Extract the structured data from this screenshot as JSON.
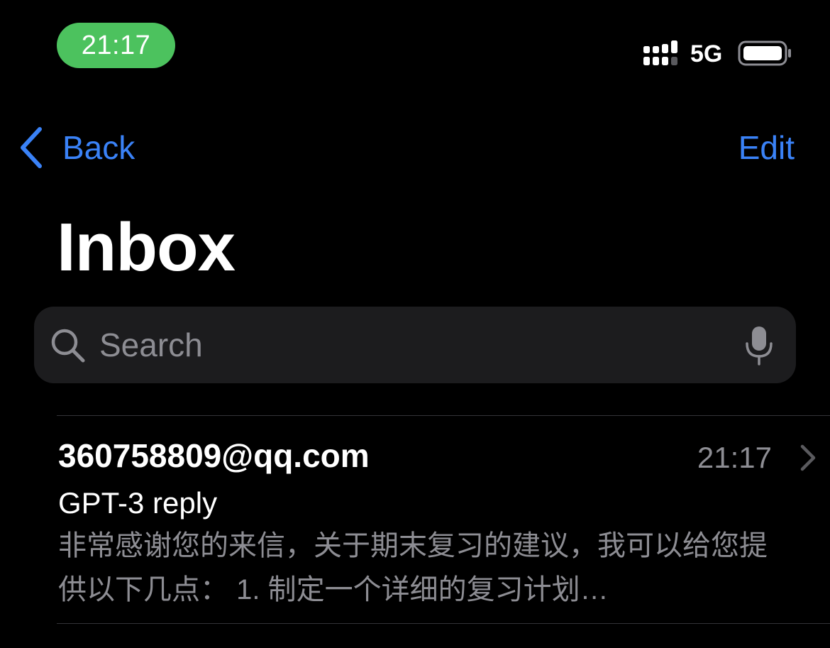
{
  "status_bar": {
    "time": "21:17",
    "network": "5G",
    "icons": [
      "signal-icon",
      "battery-icon"
    ],
    "time_pill_color": "#4cc25e"
  },
  "nav": {
    "back_label": "Back",
    "edit_label": "Edit",
    "accent_color": "#3a82f7"
  },
  "page": {
    "title": "Inbox"
  },
  "search": {
    "placeholder": "Search",
    "icons": [
      "search-icon",
      "microphone-icon"
    ]
  },
  "messages": [
    {
      "sender": "360758809@qq.com",
      "time": "21:17",
      "subject": "GPT-3 reply",
      "preview": "非常感谢您的来信，关于期末复习的建议，我可以给您提供以下几点： 1. 制定一个详细的复习计划…"
    }
  ]
}
